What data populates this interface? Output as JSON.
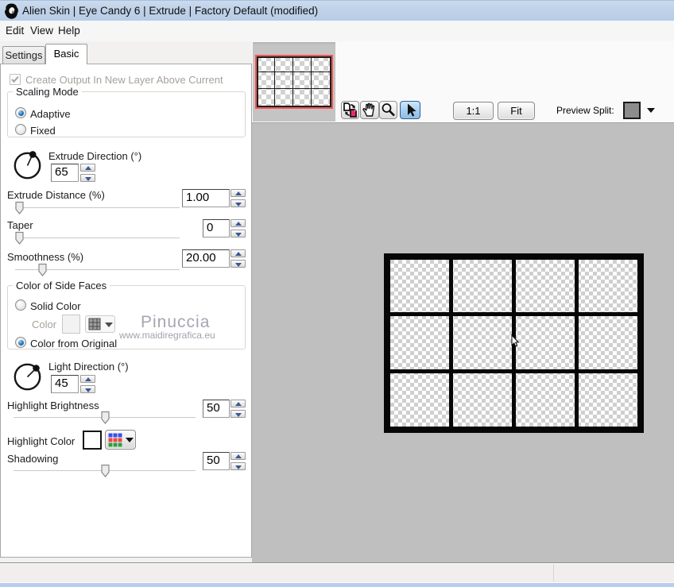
{
  "titlebar": {
    "title": "Alien Skin | Eye Candy 6 | Extrude | Factory Default (modified)"
  },
  "menu": {
    "edit": "Edit",
    "view": "View",
    "help": "Help"
  },
  "tabs": {
    "settings": "Settings",
    "basic": "Basic"
  },
  "panel": {
    "create_output": "Create Output In New Layer Above Current",
    "scaling_mode": {
      "title": "Scaling Mode",
      "adaptive": "Adaptive",
      "fixed": "Fixed"
    },
    "extrude_direction": {
      "label": "Extrude Direction (°)",
      "value": "65"
    },
    "extrude_distance": {
      "label": "Extrude Distance (%)",
      "value": "1.00"
    },
    "taper": {
      "label": "Taper",
      "value": "0"
    },
    "smoothness": {
      "label": "Smoothness (%)",
      "value": "20.00"
    },
    "side_faces": {
      "title": "Color of Side Faces",
      "solid_color": "Solid Color",
      "color_label": "Color",
      "from_original": "Color from Original"
    },
    "watermark": {
      "name": "Pinuccia",
      "url": "www.maidiregrafica.eu"
    },
    "light_direction": {
      "label": "Light Direction (°)",
      "value": "45"
    },
    "highlight_brightness": {
      "label": "Highlight Brightness",
      "value": "50"
    },
    "highlight_color": {
      "label": "Highlight Color"
    },
    "shadowing": {
      "label": "Shadowing",
      "value": "50"
    }
  },
  "toolbar": {
    "one_to_one": "1:1",
    "fit": "Fit",
    "preview_split": "Preview Split:"
  },
  "colors": {
    "titlebar": "#bfd2e9",
    "preview_bg": "#bfbfbf",
    "checker_light": "#ffffff",
    "checker_dark": "#cfcfcf",
    "thumb_border": "#f25555",
    "selected_tool": "#a6cdee",
    "statusbar": "#f2eeee",
    "bottom_strip": "#b7cfec"
  }
}
